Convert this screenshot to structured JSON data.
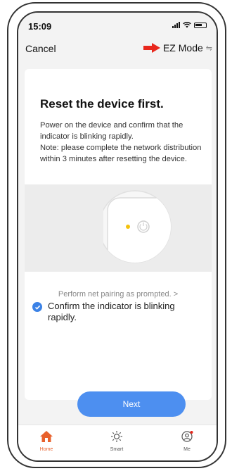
{
  "status_bar": {
    "time": "15:09"
  },
  "header": {
    "cancel_label": "Cancel",
    "mode_label": "EZ Mode",
    "arrow_color": "#e8271c"
  },
  "main": {
    "title": "Reset the device first.",
    "description": "Power on the device and confirm that the indicator is blinking rapidly.\nNote: please complete the network distribution within 3 minutes after resetting the device.",
    "pairing_link": "Perform net pairing as prompted. >",
    "confirm_text": "Confirm the indicator is blinking rapidly.",
    "next_label": "Next"
  },
  "tabbar": {
    "tabs": [
      {
        "label": "Home",
        "icon": "home-icon",
        "active": true
      },
      {
        "label": "Smart",
        "icon": "sun-icon",
        "active": false
      },
      {
        "label": "Me",
        "icon": "profile-icon",
        "active": false
      }
    ]
  },
  "colors": {
    "accent": "#4d8ff0",
    "active_tab": "#e8612c",
    "indicator_light": "#f4c20d"
  }
}
